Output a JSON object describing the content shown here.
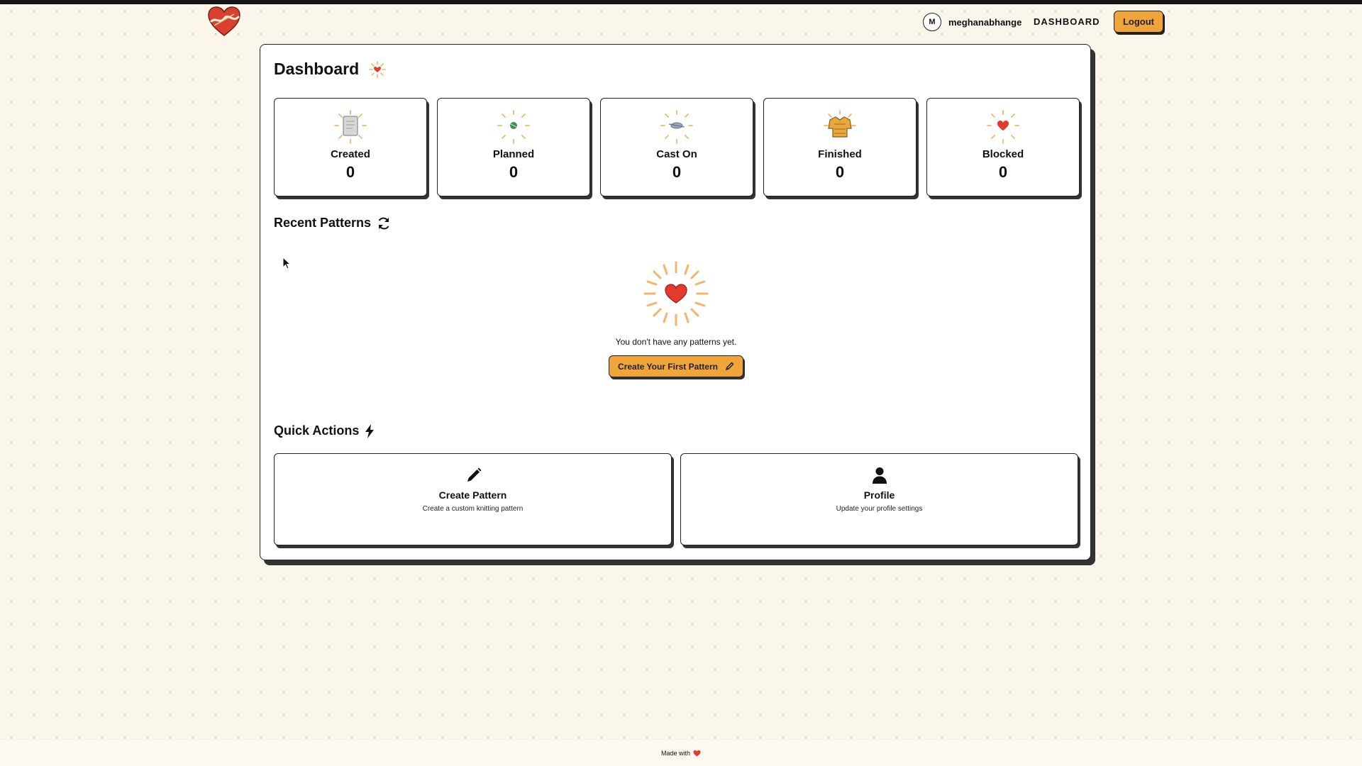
{
  "app": {
    "logo_alt": "Twisted"
  },
  "navbar": {
    "avatar_initial": "M",
    "username": "meghanabhange",
    "dashboard_link": "DASHBOARD",
    "logout_label": "Logout"
  },
  "dashboard": {
    "title": "Dashboard",
    "stats": [
      {
        "label": "Created",
        "value": "0",
        "icon": "document-icon"
      },
      {
        "label": "Planned",
        "value": "0",
        "icon": "yarn-ball-icon"
      },
      {
        "label": "Cast On",
        "value": "0",
        "icon": "needles-icon"
      },
      {
        "label": "Finished",
        "value": "0",
        "icon": "sweater-icon"
      },
      {
        "label": "Blocked",
        "value": "0",
        "icon": "heart-icon"
      }
    ],
    "recent_patterns": {
      "title": "Recent Patterns",
      "empty_text": "You don't have any patterns yet.",
      "cta_label": "Create Your First Pattern"
    },
    "quick_actions": {
      "title": "Quick Actions",
      "items": [
        {
          "title": "Create Pattern",
          "description": "Create a custom knitting pattern",
          "icon": "pencil-icon"
        },
        {
          "title": "Profile",
          "description": "Update your profile settings",
          "icon": "user-icon"
        }
      ]
    }
  },
  "footer": {
    "text": "Made with"
  },
  "colors": {
    "accent": "#f0a53a",
    "heart": "#e23b2e",
    "background": "#faf6ec"
  }
}
